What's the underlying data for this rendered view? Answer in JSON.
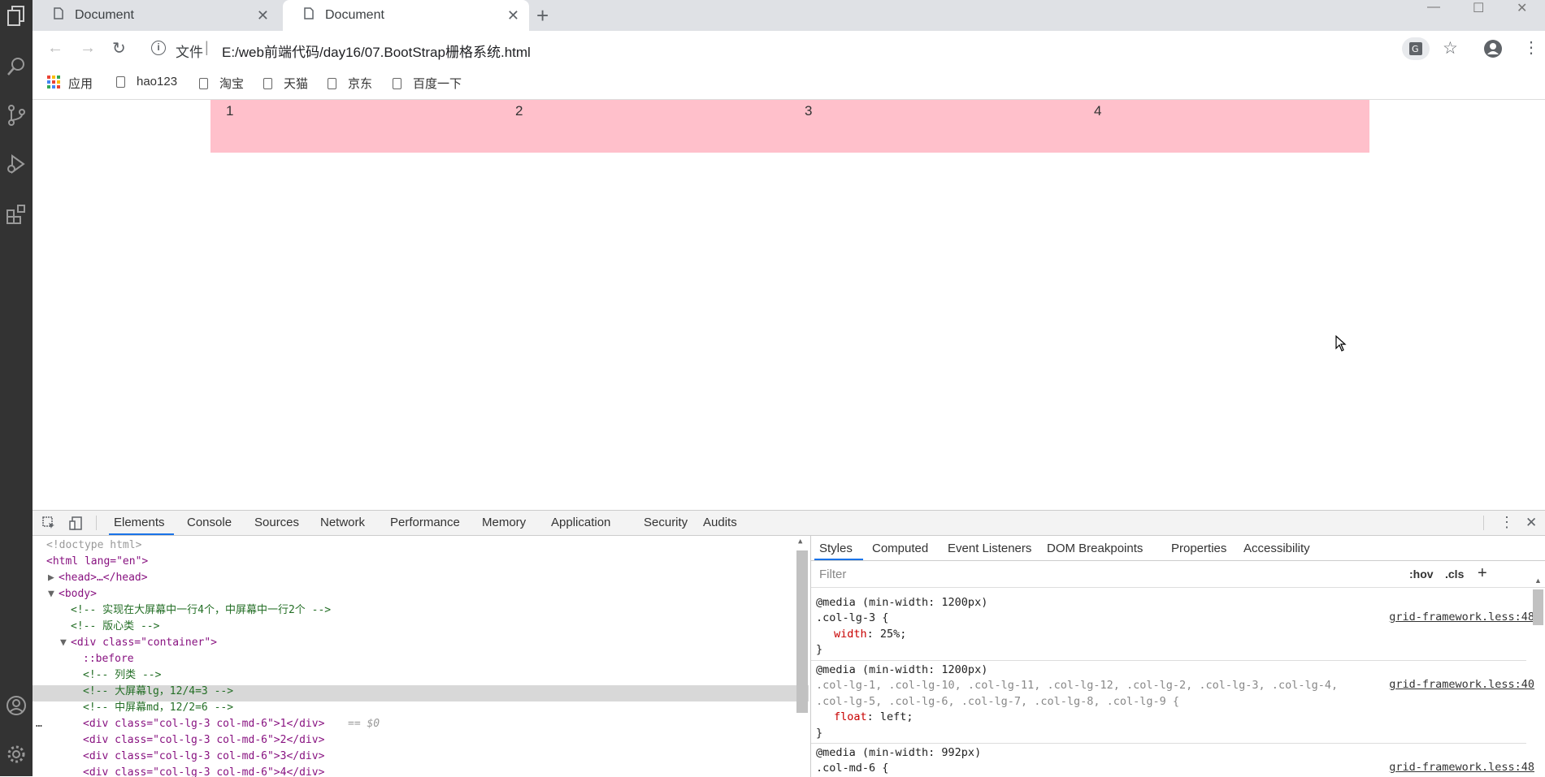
{
  "browser": {
    "tabs": [
      {
        "title": "Document"
      },
      {
        "title": "Document"
      }
    ],
    "address": {
      "info": "文件",
      "url": "E:/web前端代码/day16/07.BootStrap栅格系统.html"
    },
    "bookmarks": [
      {
        "label": "应用"
      },
      {
        "label": "hao123"
      },
      {
        "label": "淘宝"
      },
      {
        "label": "天猫"
      },
      {
        "label": "京东"
      },
      {
        "label": "百度一下"
      }
    ]
  },
  "page": {
    "columns": [
      "1",
      "2",
      "3",
      "4"
    ],
    "row_color": "#ffc0cb"
  },
  "devtools": {
    "tabs": [
      "Elements",
      "Console",
      "Sources",
      "Network",
      "Performance",
      "Memory",
      "Application",
      "Security",
      "Audits"
    ],
    "dom": {
      "doctype": "<!doctype html>",
      "html_open": "<html lang=\"en\">",
      "head": "<head>…</head>",
      "body": "<body>",
      "comment1": "<!-- 实现在大屏幕中一行4个，中屏幕中一行2个 -->",
      "comment2": "<!-- 版心类 -->",
      "container": "<div class=\"container\">",
      "before": "::before",
      "comment3": "<!-- 列类 -->",
      "comment4": "<!-- 大屏幕lg，12/4=3 -->",
      "comment5": "<!-- 中屏幕md，12/2=6 -->",
      "div1": "<div class=\"col-lg-3 col-md-6\">1</div>",
      "div1_marker": "== $0",
      "div2": "<div class=\"col-lg-3 col-md-6\">2</div>",
      "div3": "<div class=\"col-lg-3 col-md-6\">3</div>",
      "div4": "<div class=\"col-lg-3 col-md-6\">4</div>"
    },
    "styles_tabs": [
      "Styles",
      "Computed",
      "Event Listeners",
      "DOM Breakpoints",
      "Properties",
      "Accessibility"
    ],
    "filter_placeholder": "Filter",
    "hov": ":hov",
    "cls": ".cls",
    "rules": [
      {
        "media": "@media (min-width: 1200px)",
        "selector": ".col-lg-3 {",
        "decl_prop": "width",
        "decl_val": "25%;",
        "close": "}",
        "source": "grid-framework.less:48"
      },
      {
        "media": "@media (min-width: 1200px)",
        "selector_line1": ".col-lg-1, .col-lg-10, .col-lg-11, .col-lg-12, .col-lg-2, .col-lg-3, .col-lg-4,",
        "selector_line2": ".col-lg-5, .col-lg-6, .col-lg-7, .col-lg-8, .col-lg-9 {",
        "decl_prop": "float",
        "decl_val": "left;",
        "close": "}",
        "source": "grid-framework.less:40"
      },
      {
        "media": "@media (min-width: 992px)",
        "selector": ".col-md-6 {",
        "source": "grid-framework.less:48"
      }
    ]
  }
}
